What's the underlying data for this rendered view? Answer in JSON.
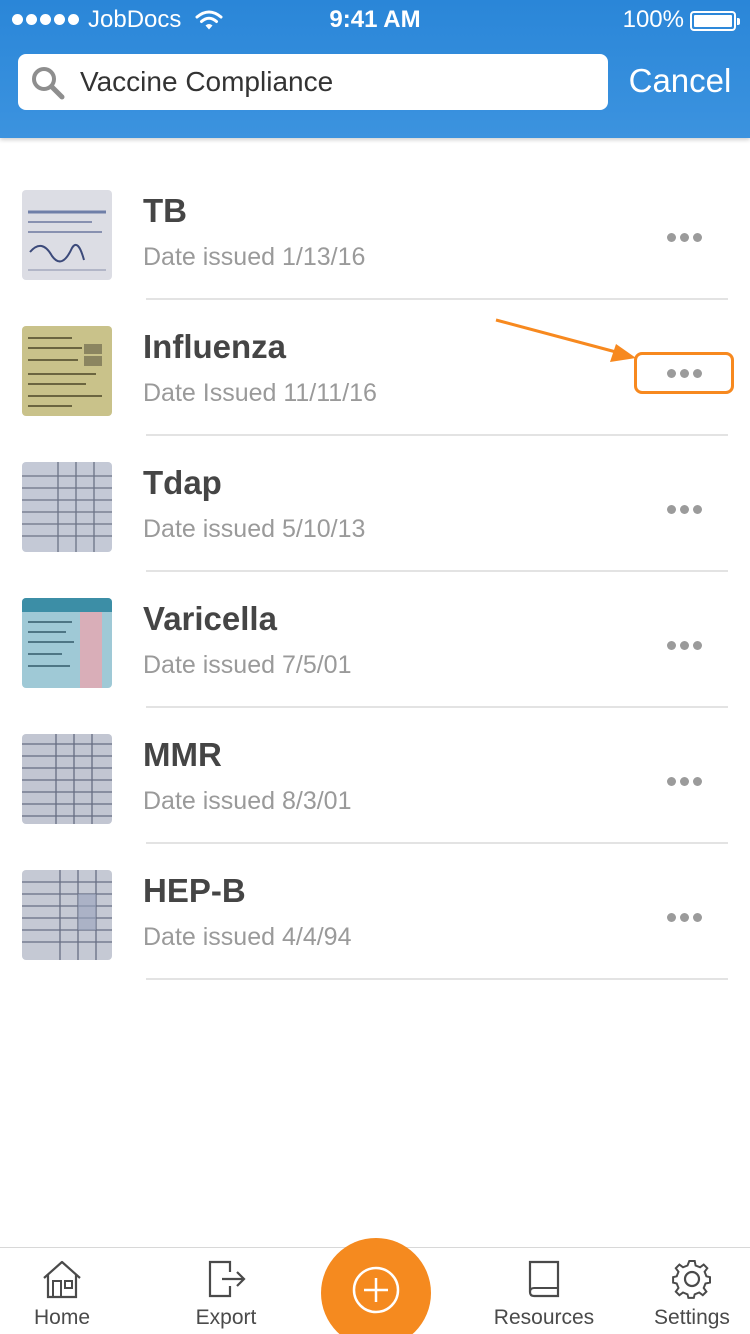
{
  "status_bar": {
    "carrier": "JobDocs",
    "time": "9:41 AM",
    "battery": "100%"
  },
  "search": {
    "value": "Vaccine Compliance",
    "cancel_label": "Cancel"
  },
  "documents": [
    {
      "title": "TB",
      "date": "Date issued 1/13/16"
    },
    {
      "title": "Influenza",
      "date": "Date Issued 11/11/16"
    },
    {
      "title": "Tdap",
      "date": "Date issued 5/10/13"
    },
    {
      "title": "Varicella",
      "date": "Date issued 7/5/01"
    },
    {
      "title": "MMR",
      "date": "Date issued 8/3/01"
    },
    {
      "title": "HEP-B",
      "date": "Date issued 4/4/94"
    }
  ],
  "tabbar": {
    "home": "Home",
    "export": "Export",
    "resources": "Resources",
    "settings": "Settings"
  },
  "colors": {
    "header": "#2a86d8",
    "accent": "#f58a1f",
    "annotation": "#f7891f"
  },
  "icons": {
    "search": "search-icon",
    "more": "more-icon",
    "home": "home-icon",
    "export": "export-icon",
    "add": "add-icon",
    "resources": "book-icon",
    "settings": "gear-icon"
  }
}
